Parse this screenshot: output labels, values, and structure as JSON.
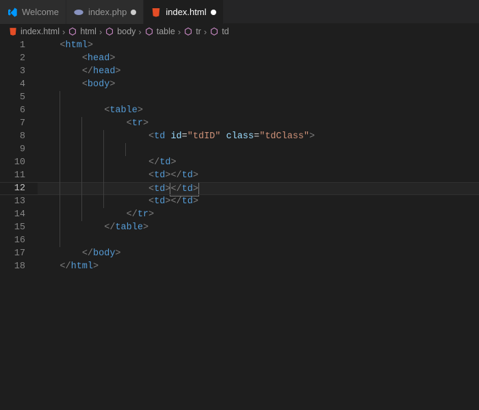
{
  "tabs": [
    {
      "label": "Welcome",
      "icon": "vscode",
      "modified": false,
      "active": false
    },
    {
      "label": "index.php",
      "icon": "php",
      "modified": true,
      "active": false
    },
    {
      "label": "index.html",
      "icon": "html",
      "modified": true,
      "active": true
    }
  ],
  "breadcrumbs": [
    {
      "label": "index.html",
      "icon": "html-file"
    },
    {
      "label": "html",
      "icon": "symbol"
    },
    {
      "label": "body",
      "icon": "symbol"
    },
    {
      "label": "table",
      "icon": "symbol"
    },
    {
      "label": "tr",
      "icon": "symbol"
    },
    {
      "label": "td",
      "icon": "symbol"
    }
  ],
  "lineNumbers": [
    "1",
    "2",
    "3",
    "4",
    "5",
    "6",
    "7",
    "8",
    "9",
    "10",
    "11",
    "12",
    "13",
    "14",
    "15",
    "16",
    "17",
    "18"
  ],
  "currentLine": 12,
  "code": {
    "l1": {
      "indent": "    ",
      "open": "<",
      "tag": "html",
      "close": ">"
    },
    "l2": {
      "indent": "        ",
      "open": "<",
      "tag": "head",
      "close": ">"
    },
    "l3": {
      "indent": "        ",
      "open": "</",
      "tag": "head",
      "close": ">"
    },
    "l4": {
      "indent": "        ",
      "open": "<",
      "tag": "body",
      "close": ">"
    },
    "l5": {
      "indent": ""
    },
    "l6": {
      "indent": "            ",
      "open": "<",
      "tag": "table",
      "close": ">"
    },
    "l7": {
      "indent": "                ",
      "open": "<",
      "tag": "tr",
      "close": ">"
    },
    "l8": {
      "indent": "                    ",
      "open": "<",
      "tag": "td",
      "sp": " ",
      "attr1": "id",
      "eq1": "=",
      "val1": "\"tdID\"",
      "sp2": " ",
      "attr2": "class",
      "eq2": "=",
      "val2": "\"tdClass\"",
      "close": ">"
    },
    "l9": {
      "indent": ""
    },
    "l10": {
      "indent": "                    ",
      "open": "</",
      "tag": "td",
      "close": ">"
    },
    "l11": {
      "indent": "                    ",
      "open1": "<",
      "tag1": "td",
      "close1": ">",
      "open2": "</",
      "tag2": "td",
      "close2": ">"
    },
    "l12": {
      "indent": "                    ",
      "open1": "<",
      "tag1": "td",
      "close1": ">",
      "open2": "</",
      "tag2": "td",
      "close2": ">"
    },
    "l13": {
      "indent": "                    ",
      "open1": "<",
      "tag1": "td",
      "close1": ">",
      "open2": "</",
      "tag2": "td",
      "close2": ">"
    },
    "l14": {
      "indent": "                ",
      "open": "</",
      "tag": "tr",
      "close": ">"
    },
    "l15": {
      "indent": "            ",
      "open": "</",
      "tag": "table",
      "close": ">"
    },
    "l16": {
      "indent": ""
    },
    "l17": {
      "indent": "        ",
      "open": "</",
      "tag": "body",
      "close": ">"
    },
    "l18": {
      "indent": "    ",
      "open": "</",
      "tag": "html",
      "close": ">"
    }
  }
}
